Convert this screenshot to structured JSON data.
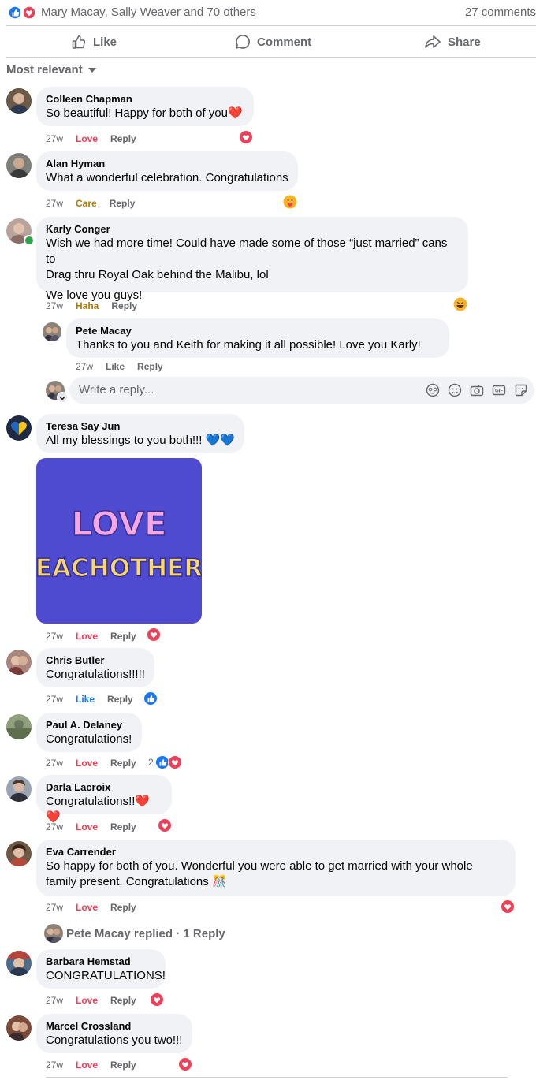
{
  "summary": {
    "reactors": "Mary Macay, Sally Weaver and 70 others",
    "comment_count": "27 comments"
  },
  "actions": {
    "like": "Like",
    "comment": "Comment",
    "share": "Share"
  },
  "sort": {
    "label": "Most relevant"
  },
  "reply_input": {
    "placeholder": "Write a reply..."
  },
  "gif": {
    "line1": "LOVE",
    "line2": "EACHOTHER"
  },
  "comments": [
    {
      "name": "Colleen Chapman",
      "text": "So beautiful! Happy for both of you❤️",
      "time": "27w",
      "reaction": "Love",
      "reply": "Reply"
    },
    {
      "name": "Alan Hyman",
      "text": "What a wonderful celebration. Congratulations",
      "time": "27w",
      "reaction": "Care",
      "reply": "Reply"
    },
    {
      "name": "Karly Conger",
      "text1": "Wish we had more time! Could have made some of those “just married” cans to",
      "text2": "Drag thru Royal Oak behind the Malibu, lol",
      "text3": "We love you guys!",
      "time": "27w",
      "reaction": "Haha",
      "reply": "Reply"
    },
    {
      "name": "Pete Macay",
      "text": "Thanks to you and Keith for making it all possible! Love you Karly!",
      "time": "27w",
      "reaction": "Like",
      "reply": "Reply"
    },
    {
      "name": "Teresa Say Jun",
      "text": "All my blessings to you both!!! 💙💙",
      "time": "27w",
      "reaction": "Love",
      "reply": "Reply"
    },
    {
      "name": "Chris Butler",
      "text": "Congratulations!!!!!",
      "time": "27w",
      "reaction": "Like",
      "reply": "Reply"
    },
    {
      "name": "Paul A. Delaney",
      "text": "Congratulations!",
      "time": "27w",
      "reaction": "Love",
      "reply": "Reply",
      "react_count": "2"
    },
    {
      "name": "Darla Lacroix",
      "text": "Congratulations!!❤️ ❤️",
      "time": "27w",
      "reaction": "Love",
      "reply": "Reply"
    },
    {
      "name": "Eva Carrender",
      "text1": "So happy for both of you. Wonderful you were able to get married with your whole",
      "text2": "family present. Congratulations 🎊",
      "time": "27w",
      "reaction": "Love",
      "reply": "Reply"
    },
    {
      "name": "Barbara Hemstad",
      "text": "CONGRATULATIONS!",
      "time": "27w",
      "reaction": "Love",
      "reply": "Reply"
    },
    {
      "name": "Marcel Crossland",
      "text": "Congratulations you two!!!",
      "time": "27w",
      "reaction": "Love",
      "reply": "Reply"
    }
  ],
  "replied": {
    "text": "Pete Macay replied · 1 Reply"
  },
  "colors": {
    "love": "#f33e58",
    "like": "#1877f2",
    "bubble": "#f0f2f5",
    "secondary": "#65676b"
  }
}
